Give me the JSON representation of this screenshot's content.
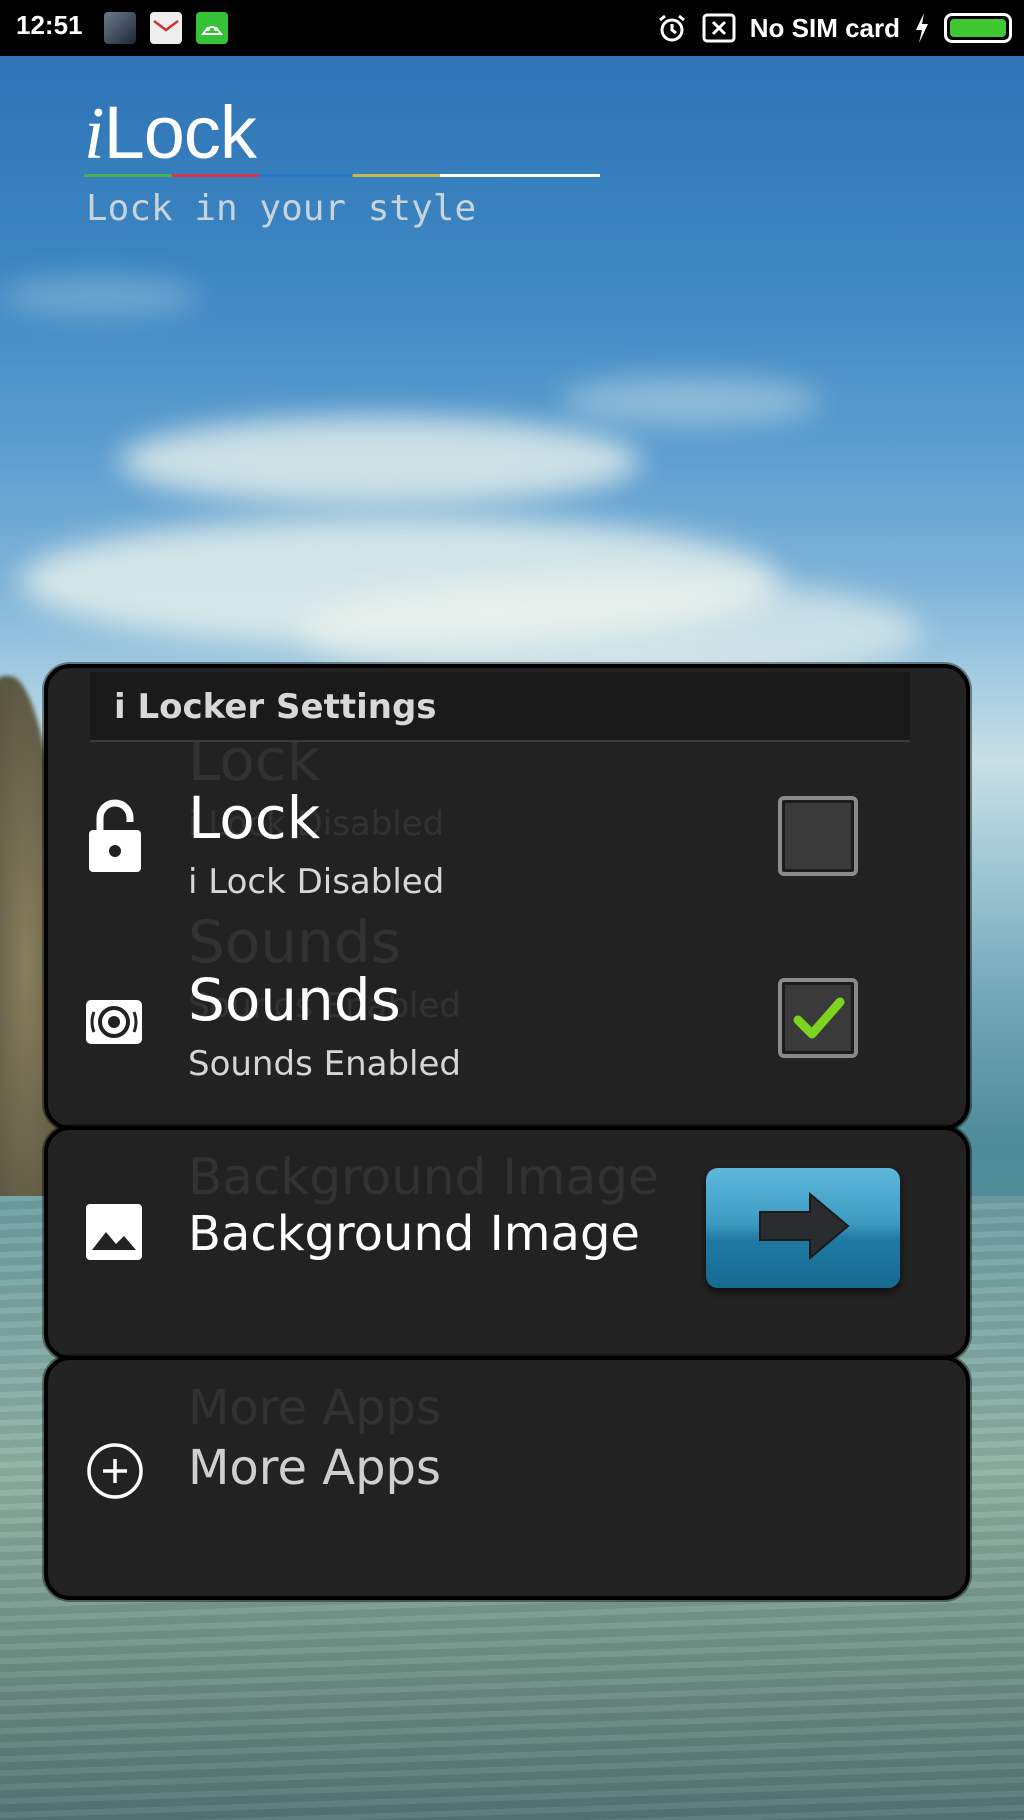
{
  "status_bar": {
    "time": "12:51",
    "carrier": "No SIM card",
    "battery_color": "#3fc832"
  },
  "logo": {
    "letter": "i",
    "word": "Lock",
    "tagline": "Lock in your style"
  },
  "settings": {
    "header": "i Locker Settings",
    "lock": {
      "title": "Lock",
      "subtitle": "i Lock Disabled",
      "checked": false,
      "icon": "lock-open-icon"
    },
    "sounds": {
      "title": "Sounds",
      "subtitle": "Sounds Enabled",
      "checked": true,
      "icon": "speaker-icon"
    }
  },
  "background_image": {
    "label": "Background Image",
    "icon": "image-icon",
    "button_icon": "arrow-right-icon"
  },
  "more_apps": {
    "label": "More Apps",
    "icon": "add-circle-icon"
  },
  "colors": {
    "panel": "#222222",
    "check": "#7ed321",
    "button": "#3e9cc3"
  }
}
